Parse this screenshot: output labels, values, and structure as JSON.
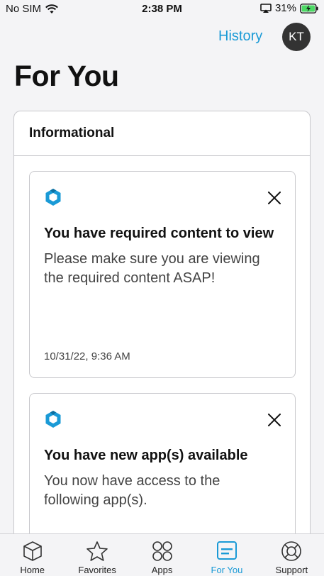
{
  "status_bar": {
    "carrier": "No SIM",
    "time": "2:38 PM",
    "battery": "31%"
  },
  "header": {
    "history_label": "History",
    "avatar_initials": "KT"
  },
  "page_title": "For You",
  "section": {
    "title": "Informational",
    "cards": [
      {
        "title": "You have required content to view",
        "body": "Please make sure you are viewing the required content ASAP!",
        "timestamp": "10/31/22, 9:36 AM"
      },
      {
        "title": "You have new app(s) available",
        "body": "You now have access to the following app(s).",
        "timestamp": ""
      }
    ]
  },
  "tabs": [
    {
      "label": "Home",
      "icon": "box-icon",
      "active": false
    },
    {
      "label": "Favorites",
      "icon": "star-icon",
      "active": false
    },
    {
      "label": "Apps",
      "icon": "apps-grid-icon",
      "active": false
    },
    {
      "label": "For You",
      "icon": "for-you-icon",
      "active": true
    },
    {
      "label": "Support",
      "icon": "lifebuoy-icon",
      "active": false
    }
  ],
  "colors": {
    "accent": "#1a9ad6",
    "avatar_bg": "#333333",
    "battery_fill": "#4cd964"
  }
}
